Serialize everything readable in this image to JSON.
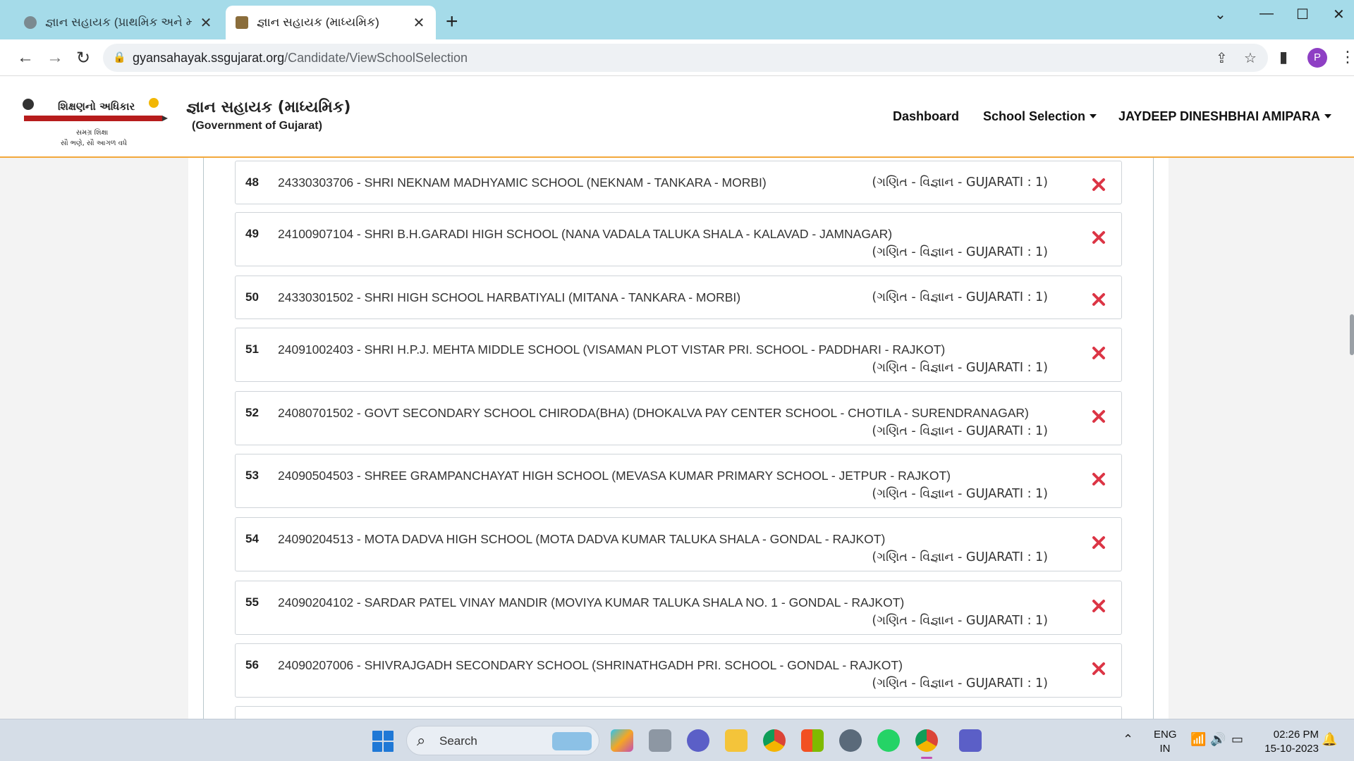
{
  "browser": {
    "tabs": [
      {
        "title": "જ્ઞાન સહાયક (પ્રાથમિક અને માધ્યમિ",
        "active": false
      },
      {
        "title": "જ્ઞાન સહાયક (માધ્યમિક)",
        "active": true
      }
    ],
    "url_host": "gyansahayak.ssgujarat.org",
    "url_path": "/Candidate/ViewSchoolSelection",
    "profile_initial": "P"
  },
  "site": {
    "logo_text": "શિક્ષણનો અધિકાર",
    "logo_sub1": "સમગ્ર શિક્ષા",
    "logo_sub2": "સૌ ભણે, સૌ આગળ વધે",
    "title": "જ્ઞાન સહાયક (માધ્યમિક)",
    "subtitle": "(Government of Gujarat)",
    "nav": {
      "dashboard": "Dashboard",
      "school_selection": "School Selection",
      "user": "JAYDEEP DINESHBHAI AMIPARA"
    }
  },
  "schools": [
    {
      "no": "48",
      "text": "24330303706 - SHRI NEKNAM MADHYAMIC SCHOOL (NEKNAM - TANKARA - MORBI)",
      "subject": "(ગણિત - વિજ્ઞાન - GUJARATI : 1)"
    },
    {
      "no": "49",
      "text": "24100907104 - SHRI B.H.GARADI HIGH SCHOOL (NANA VADALA TALUKA SHALA - KALAVAD - JAMNAGAR)",
      "subject": "(ગણિત - વિજ્ઞાન - GUJARATI : 1)"
    },
    {
      "no": "50",
      "text": "24330301502 - SHRI HIGH SCHOOL HARBATIYALI (MITANA - TANKARA - MORBI)",
      "subject": "(ગણિત - વિજ્ઞાન - GUJARATI : 1)"
    },
    {
      "no": "51",
      "text": "24091002403 - SHRI H.P.J. MEHTA MIDDLE SCHOOL (VISAMAN PLOT VISTAR PRI. SCHOOL - PADDHARI - RAJKOT)",
      "subject": "(ગણિત - વિજ્ઞાન - GUJARATI : 1)"
    },
    {
      "no": "52",
      "text": "24080701502 - GOVT SECONDARY SCHOOL CHIRODA(BHA) (DHOKALVA PAY CENTER SCHOOL - CHOTILA - SURENDRANAGAR)",
      "subject": "(ગણિત - વિજ્ઞાન - GUJARATI : 1)"
    },
    {
      "no": "53",
      "text": "24090504503 - SHREE GRAMPANCHAYAT HIGH SCHOOL (MEVASA KUMAR PRIMARY SCHOOL - JETPUR - RAJKOT)",
      "subject": "(ગણિત - વિજ્ઞાન - GUJARATI : 1)"
    },
    {
      "no": "54",
      "text": "24090204513 - MOTA DADVA HIGH SCHOOL (MOTA DADVA KUMAR TALUKA SHALA - GONDAL - RAJKOT)",
      "subject": "(ગણિત - વિજ્ઞાન - GUJARATI : 1)"
    },
    {
      "no": "55",
      "text": "24090204102 - SARDAR PATEL VINAY MANDIR (MOVIYA KUMAR TALUKA SHALA NO. 1 - GONDAL - RAJKOT)",
      "subject": "(ગણિત - વિજ્ઞાન - GUJARATI : 1)"
    },
    {
      "no": "56",
      "text": "24090207006 - SHIVRAJGADH SECONDARY SCHOOL (SHRINATHGADH PRI. SCHOOL - GONDAL - RAJKOT)",
      "subject": "(ગણિત - વિજ્ઞાન - GUJARATI : 1)"
    }
  ],
  "taskbar": {
    "search_label": "Search",
    "lang_line1": "ENG",
    "lang_line2": "IN",
    "time": "02:26 PM",
    "date": "15-10-2023"
  },
  "colors": {
    "tabstrip": "#a5dbe9",
    "header_border": "#f3a83b",
    "delete_icon": "#dc3545"
  }
}
